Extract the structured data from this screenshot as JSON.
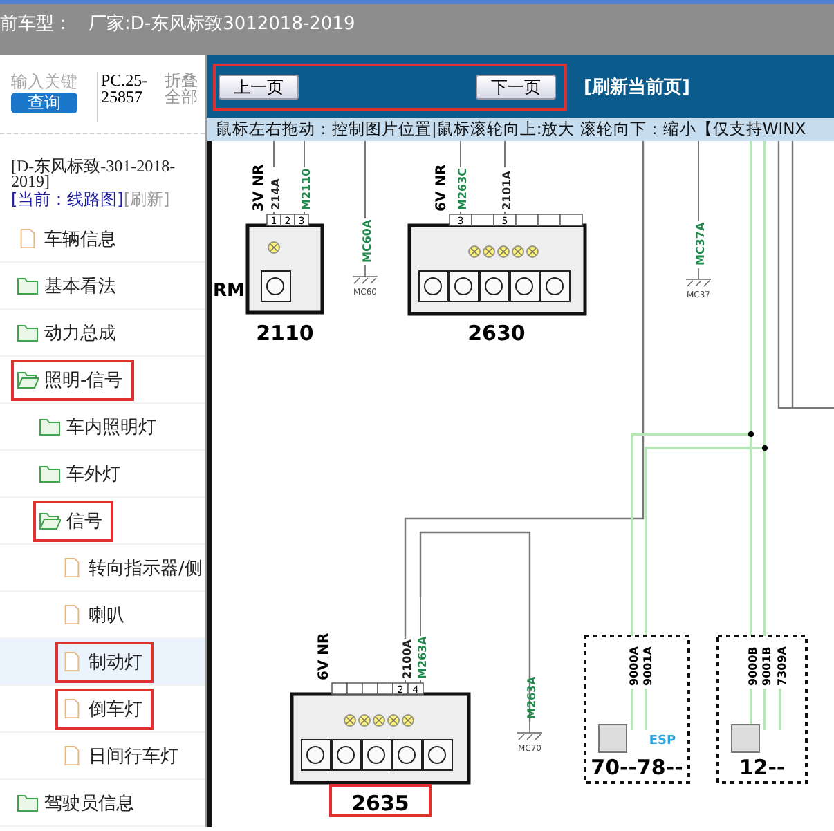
{
  "header": {
    "label": "前车型：",
    "maker": "厂家:D-东风标致3012018-2019"
  },
  "sidebar": {
    "search": {
      "placeholder": "输入关键",
      "button": "查询"
    },
    "code": "PC.25-25857",
    "collapse_all": "折叠全部",
    "model": "[D-东风标致-301-2018-2019]",
    "current": "[当前：线路图]",
    "refresh": "[刷新]",
    "tree": [
      {
        "label": "车辆信息",
        "kind": "document",
        "selected": false,
        "highlighted": false
      },
      {
        "label": "基本看法",
        "kind": "folder",
        "expanded": false,
        "selected": false,
        "highlighted": false
      },
      {
        "label": "动力总成",
        "kind": "folder",
        "expanded": false,
        "selected": false,
        "highlighted": false
      },
      {
        "label": "照明-信号",
        "kind": "folder",
        "expanded": true,
        "selected": false,
        "highlighted": true,
        "children": [
          {
            "label": "车内照明灯",
            "kind": "folder",
            "expanded": false,
            "selected": false,
            "highlighted": false
          },
          {
            "label": "车外灯",
            "kind": "folder",
            "expanded": false,
            "selected": false,
            "highlighted": false
          },
          {
            "label": "信号",
            "kind": "folder",
            "expanded": true,
            "selected": false,
            "highlighted": true,
            "children": [
              {
                "label": "转向指示器/侧",
                "kind": "document",
                "selected": false,
                "highlighted": false
              },
              {
                "label": "喇叭",
                "kind": "document",
                "selected": false,
                "highlighted": false
              },
              {
                "label": "制动灯",
                "kind": "document",
                "selected": true,
                "highlighted": true
              },
              {
                "label": "倒车灯",
                "kind": "document",
                "selected": false,
                "highlighted": true
              },
              {
                "label": "日间行车灯",
                "kind": "document",
                "selected": false,
                "highlighted": false
              }
            ]
          }
        ]
      },
      {
        "label": "驾驶员信息",
        "kind": "folder",
        "expanded": false,
        "selected": false,
        "highlighted": false
      }
    ]
  },
  "toolbar": {
    "prev": "上一页",
    "next": "下一页",
    "highlighted": true,
    "refresh": "[刷新当前页]",
    "hint": "鼠标左右拖动：控制图片位置|鼠标滚轮向上:放大  滚轮向下：缩小【仅支持WINX"
  },
  "diagram": {
    "edge_label": "RM",
    "components": [
      {
        "number": "2110",
        "voltage": "3V NR",
        "pins": [
          "1",
          "2",
          "3"
        ],
        "highlighted": false,
        "wires": [
          {
            "label": "214A",
            "color": "#222222"
          },
          {
            "label": "M2110",
            "color": "#1f8a4c"
          }
        ]
      },
      {
        "number": "2630",
        "voltage": "6V NR",
        "pins": [
          "3",
          "5"
        ],
        "highlighted": false,
        "wires": [
          {
            "label": "M263C",
            "color": "#1f8a4c"
          },
          {
            "label": "2101A",
            "color": "#222222"
          }
        ]
      },
      {
        "number": "2635",
        "voltage": "6V NR",
        "pins": [
          "2",
          "4"
        ],
        "highlighted": true,
        "wires": [
          {
            "label": "2100A",
            "color": "#222222"
          },
          {
            "label": "M263A",
            "color": "#1f8a4c"
          }
        ]
      }
    ],
    "grounds": [
      {
        "wire": "MC60A",
        "ground": "MC60"
      },
      {
        "wire": "MC37A",
        "ground": "MC37"
      },
      {
        "wire": "M263A",
        "ground": "MC70"
      }
    ],
    "modules": [
      {
        "number": "70--78--",
        "badge": "ESP",
        "wires": [
          "9000A",
          "9001A"
        ]
      },
      {
        "number": "12--",
        "wires": [
          "9000B",
          "9001B",
          "7309A"
        ]
      }
    ]
  }
}
